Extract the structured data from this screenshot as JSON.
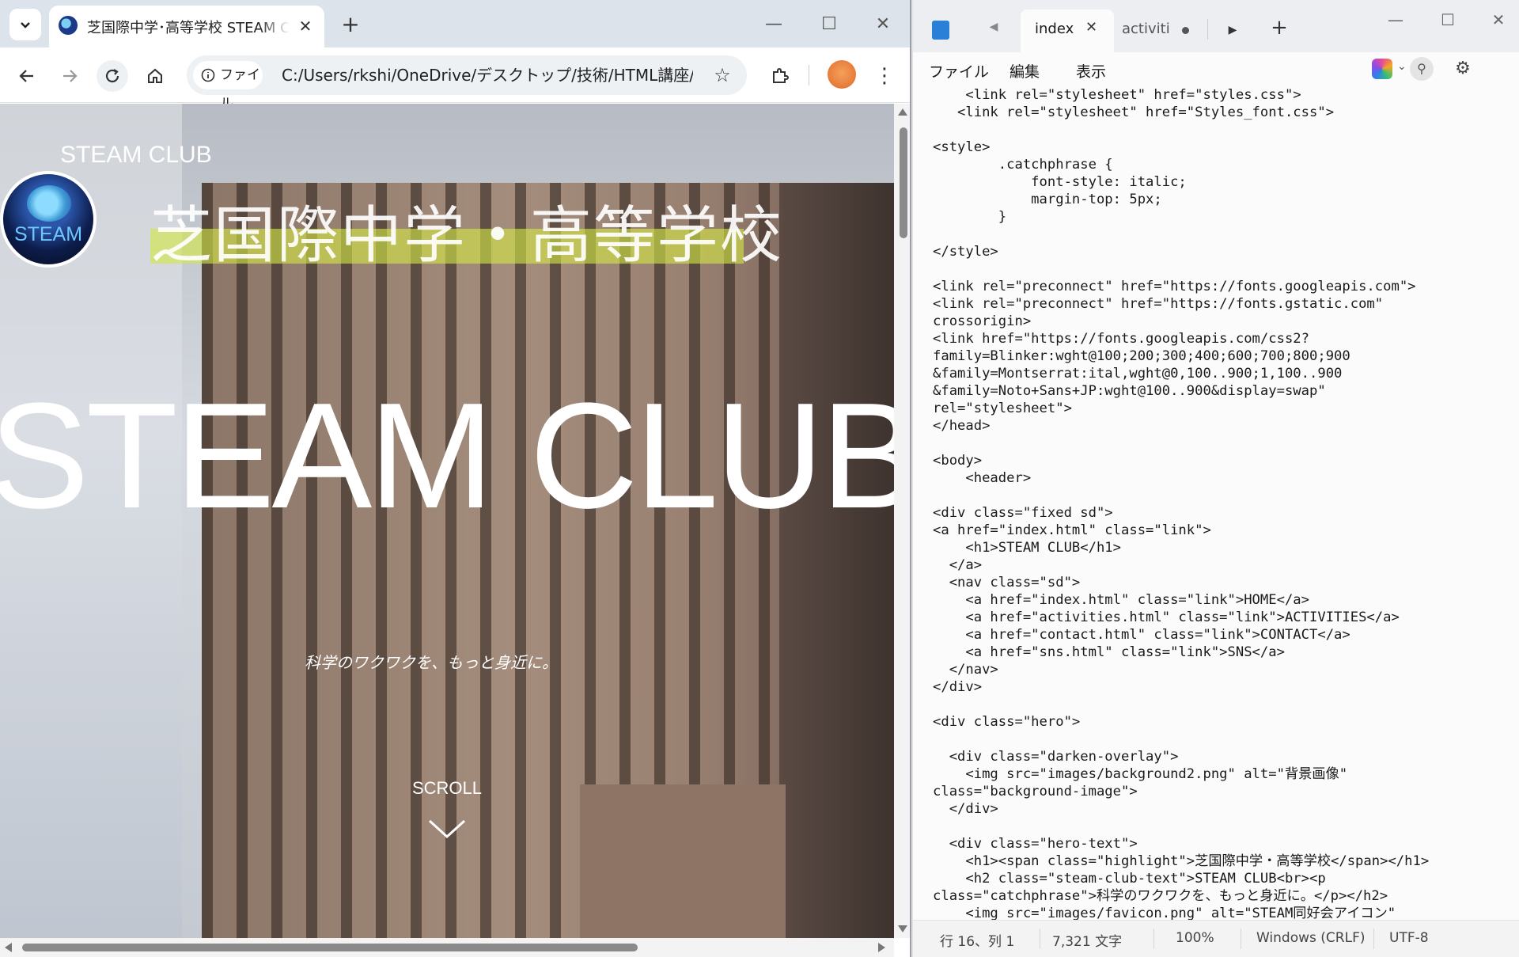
{
  "browser": {
    "tab_title": "芝国際中学･高等学校 STEAM C",
    "address_chip": "ファイル",
    "url": "C:/Users/rkshi/OneDrive/デスクトップ/技術/HTML講座/in...",
    "icons": [
      "tab-list-icon",
      "favicon-icon",
      "close-icon",
      "plus-icon",
      "minimize-icon",
      "maximize-icon",
      "back-icon",
      "forward-icon",
      "reload-icon",
      "home-icon",
      "info-icon",
      "star-icon",
      "extensions-icon",
      "profile-icon",
      "menu-icon"
    ]
  },
  "page": {
    "brand": "STEAM CLUB",
    "logo_text": "STEAM",
    "school_name": "芝国際中学・高等学校",
    "big_title": "STEAM CLUB",
    "catchphrase": "科学のワクワクを、もっと身近に。",
    "scroll_label": "SCROLL",
    "colors": {
      "highlight": "#d4e646"
    }
  },
  "notepad": {
    "tabs": [
      {
        "label": "index",
        "active": true
      },
      {
        "label": "activiti",
        "active": false,
        "unsaved": true
      }
    ],
    "menu": [
      "ファイル",
      "編集",
      "表示"
    ],
    "code_lines": [
      "    <link rel=\"stylesheet\" href=\"styles.css\">",
      "   <link rel=\"stylesheet\" href=\"Styles_font.css\">",
      "",
      "<style>",
      "        .catchphrase {",
      "            font-style: italic;",
      "            margin-top: 5px;",
      "        }",
      "",
      "</style>",
      "",
      "<link rel=\"preconnect\" href=\"https://fonts.googleapis.com\">",
      "<link rel=\"preconnect\" href=\"https://fonts.gstatic.com\"",
      "crossorigin>",
      "<link href=\"https://fonts.googleapis.com/css2?",
      "family=Blinker:wght@100;200;300;400;600;700;800;900",
      "&family=Montserrat:ital,wght@0,100..900;1,100..900",
      "&family=Noto+Sans+JP:wght@100..900&display=swap\"",
      "rel=\"stylesheet\">",
      "</head>",
      "",
      "<body>",
      "    <header>",
      "",
      "<div class=\"fixed sd\">",
      "<a href=\"index.html\" class=\"link\">",
      "    <h1>STEAM CLUB</h1>",
      "  </a>",
      "  <nav class=\"sd\">",
      "    <a href=\"index.html\" class=\"link\">HOME</a>",
      "    <a href=\"activities.html\" class=\"link\">ACTIVITIES</a>",
      "    <a href=\"contact.html\" class=\"link\">CONTACT</a>",
      "    <a href=\"sns.html\" class=\"link\">SNS</a>",
      "  </nav>",
      "</div>",
      "",
      "<div class=\"hero\">",
      "",
      "  <div class=\"darken-overlay\">",
      "    <img src=\"images/background2.png\" alt=\"背景画像\"",
      "class=\"background-image\">",
      "  </div>",
      "",
      "  <div class=\"hero-text\">",
      "    <h1><span class=\"highlight\">芝国際中学・高等学校</span></h1>",
      "    <h2 class=\"steam-club-text\">STEAM CLUB<br><p",
      "class=\"catchphrase\">科学のワクワクを、もっと身近に。</p></h2>",
      "    <img src=\"images/favicon.png\" alt=\"STEAM同好会アイコン\""
    ],
    "status": {
      "position": "行 16、列 1",
      "chars": "7,321 文字",
      "zoom": "100%",
      "line_ending": "Windows (CRLF)",
      "encoding": "UTF-8"
    }
  }
}
